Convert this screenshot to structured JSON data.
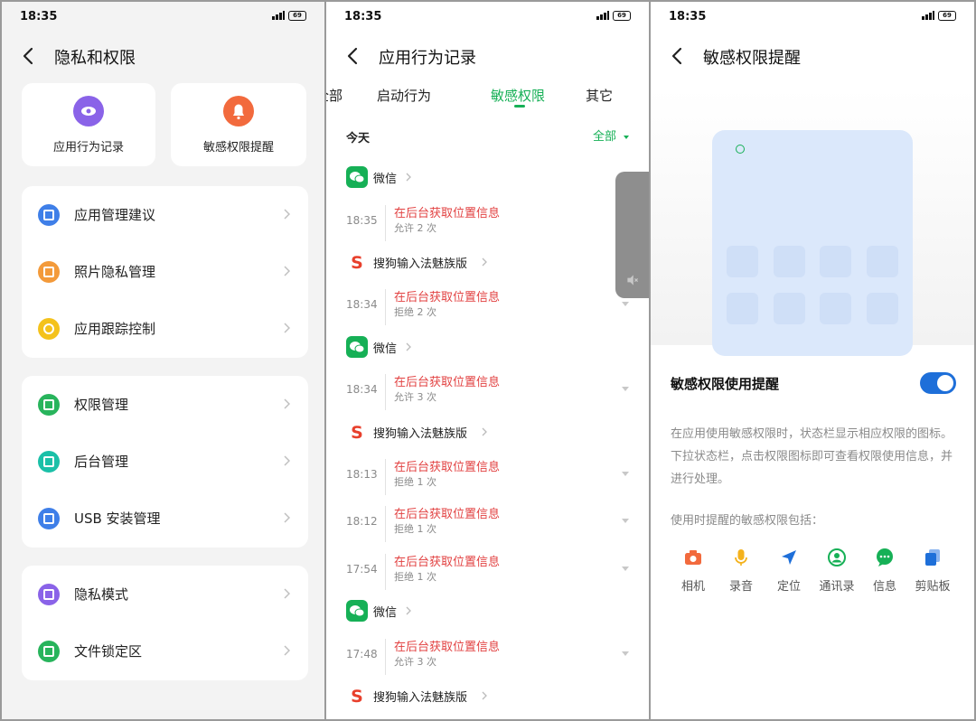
{
  "status": {
    "time": "18:35",
    "battery": "69"
  },
  "panel1": {
    "title": "隐私和权限",
    "top_cards": [
      {
        "label": "应用行为记录",
        "color": "#8a63e8",
        "icon": "eye-icon"
      },
      {
        "label": "敏感权限提醒",
        "color": "#f26a3d",
        "icon": "bell-icon"
      }
    ],
    "groups": [
      [
        {
          "label": "应用管理建议",
          "color": "#3f7fe8",
          "icon": "list-icon"
        },
        {
          "label": "照片隐私管理",
          "color": "#f39a3a",
          "icon": "image-icon"
        },
        {
          "label": "应用跟踪控制",
          "color": "#f4c21c",
          "icon": "power-icon"
        }
      ],
      [
        {
          "label": "权限管理",
          "color": "#28b45c",
          "icon": "grid-icon"
        },
        {
          "label": "后台管理",
          "color": "#1bc0a8",
          "icon": "phone-icon"
        },
        {
          "label": "USB 安装管理",
          "color": "#3f7fe8",
          "icon": "usb-icon"
        }
      ],
      [
        {
          "label": "隐私模式",
          "color": "#8a63e8",
          "icon": "lock-icon"
        },
        {
          "label": "文件锁定区",
          "color": "#28b45c",
          "icon": "file-lock-icon"
        }
      ]
    ]
  },
  "panel2": {
    "title": "应用行为记录",
    "tabs": [
      "全部",
      "启动行为",
      "敏感权限",
      "其它"
    ],
    "today": "今天",
    "filter": "全部",
    "apps": {
      "wechat": "微信",
      "sogou": "搜狗输入法魅族版"
    },
    "items": [
      {
        "kind": "app",
        "app": "wechat"
      },
      {
        "kind": "entry",
        "time": "18:35",
        "name": "在后台获取位置信息",
        "sub": "允许 2 次"
      },
      {
        "kind": "app",
        "app": "sogou"
      },
      {
        "kind": "entry",
        "time": "18:34",
        "name": "在后台获取位置信息",
        "sub": "拒绝 2 次"
      },
      {
        "kind": "app",
        "app": "wechat"
      },
      {
        "kind": "entry",
        "time": "18:34",
        "name": "在后台获取位置信息",
        "sub": "允许 3 次"
      },
      {
        "kind": "app",
        "app": "sogou"
      },
      {
        "kind": "entry",
        "time": "18:13",
        "name": "在后台获取位置信息",
        "sub": "拒绝 1 次"
      },
      {
        "kind": "entry",
        "time": "18:12",
        "name": "在后台获取位置信息",
        "sub": "拒绝 1 次"
      },
      {
        "kind": "entry",
        "time": "17:54",
        "name": "在后台获取位置信息",
        "sub": "拒绝 1 次"
      },
      {
        "kind": "app",
        "app": "wechat"
      },
      {
        "kind": "entry",
        "time": "17:48",
        "name": "在后台获取位置信息",
        "sub": "允许 3 次"
      },
      {
        "kind": "app",
        "app": "sogou"
      }
    ],
    "volume_icon": "speaker-mute-icon"
  },
  "panel3": {
    "title": "敏感权限提醒",
    "toggle_label": "敏感权限使用提醒",
    "toggle_on": true,
    "description": "在应用使用敏感权限时，状态栏显示相应权限的图标。下拉状态栏，点击权限图标即可查看权限使用信息，并进行处理。",
    "includes_label": "使用时提醒的敏感权限包括：",
    "permissions": [
      {
        "label": "相机",
        "icon": "camera-icon",
        "color": "#f26a3d"
      },
      {
        "label": "录音",
        "icon": "mic-icon",
        "color": "#f4b21c"
      },
      {
        "label": "定位",
        "icon": "location-icon",
        "color": "#1e6fd9"
      },
      {
        "label": "通讯录",
        "icon": "contacts-icon",
        "color": "#16b056"
      },
      {
        "label": "信息",
        "icon": "message-icon",
        "color": "#16b056"
      },
      {
        "label": "剪贴板",
        "icon": "clipboard-icon",
        "color": "#1e6fd9"
      }
    ]
  }
}
